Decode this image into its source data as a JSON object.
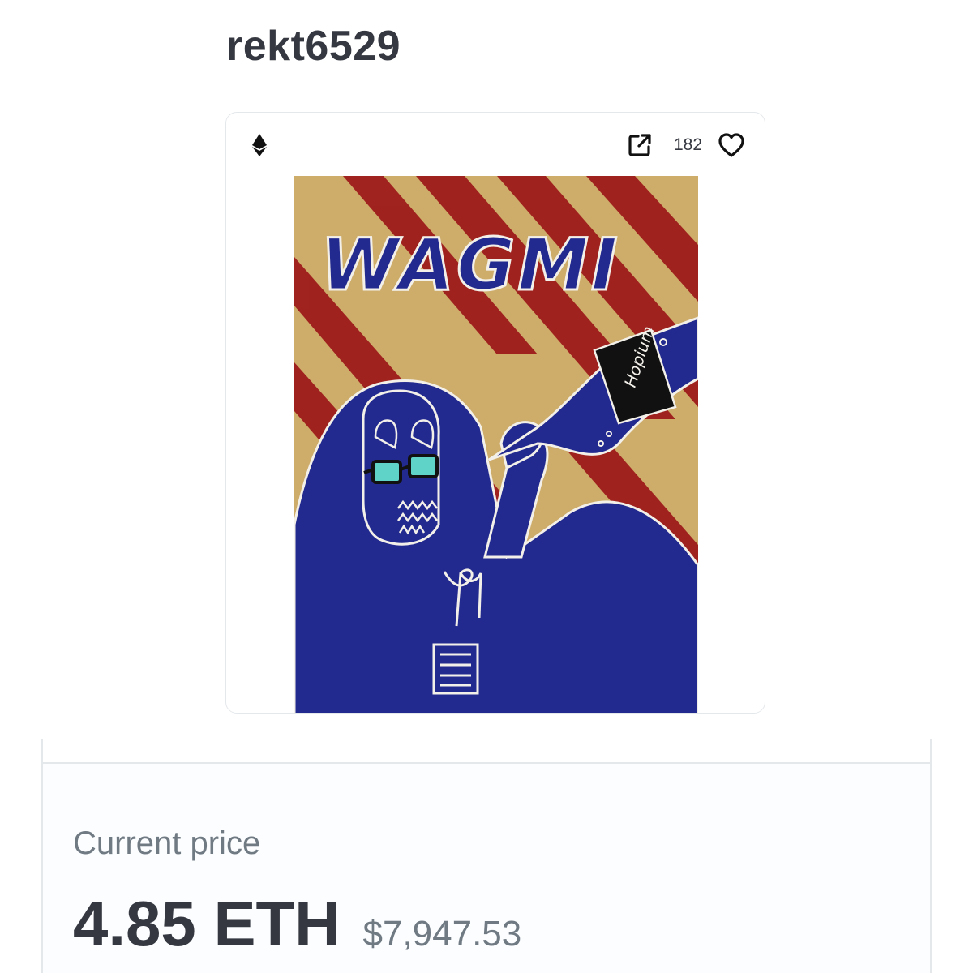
{
  "item": {
    "name": "rekt6529"
  },
  "card": {
    "chain_icon": "ethereum-icon",
    "external_link_icon": "external-link-icon",
    "favorites_count": "182",
    "favorite_icon": "heart-icon",
    "artwork": {
      "text": "WAGMI",
      "bottle_label": "Hopium",
      "colors": {
        "background": "#c9a562",
        "stripes": "#9e1b1b",
        "figure": "#232a8f",
        "outline": "#f3f0ea",
        "lenses": "#5fd3c8"
      }
    }
  },
  "price": {
    "label": "Current price",
    "eth": "4.85 ETH",
    "usd": "$7,947.53"
  }
}
